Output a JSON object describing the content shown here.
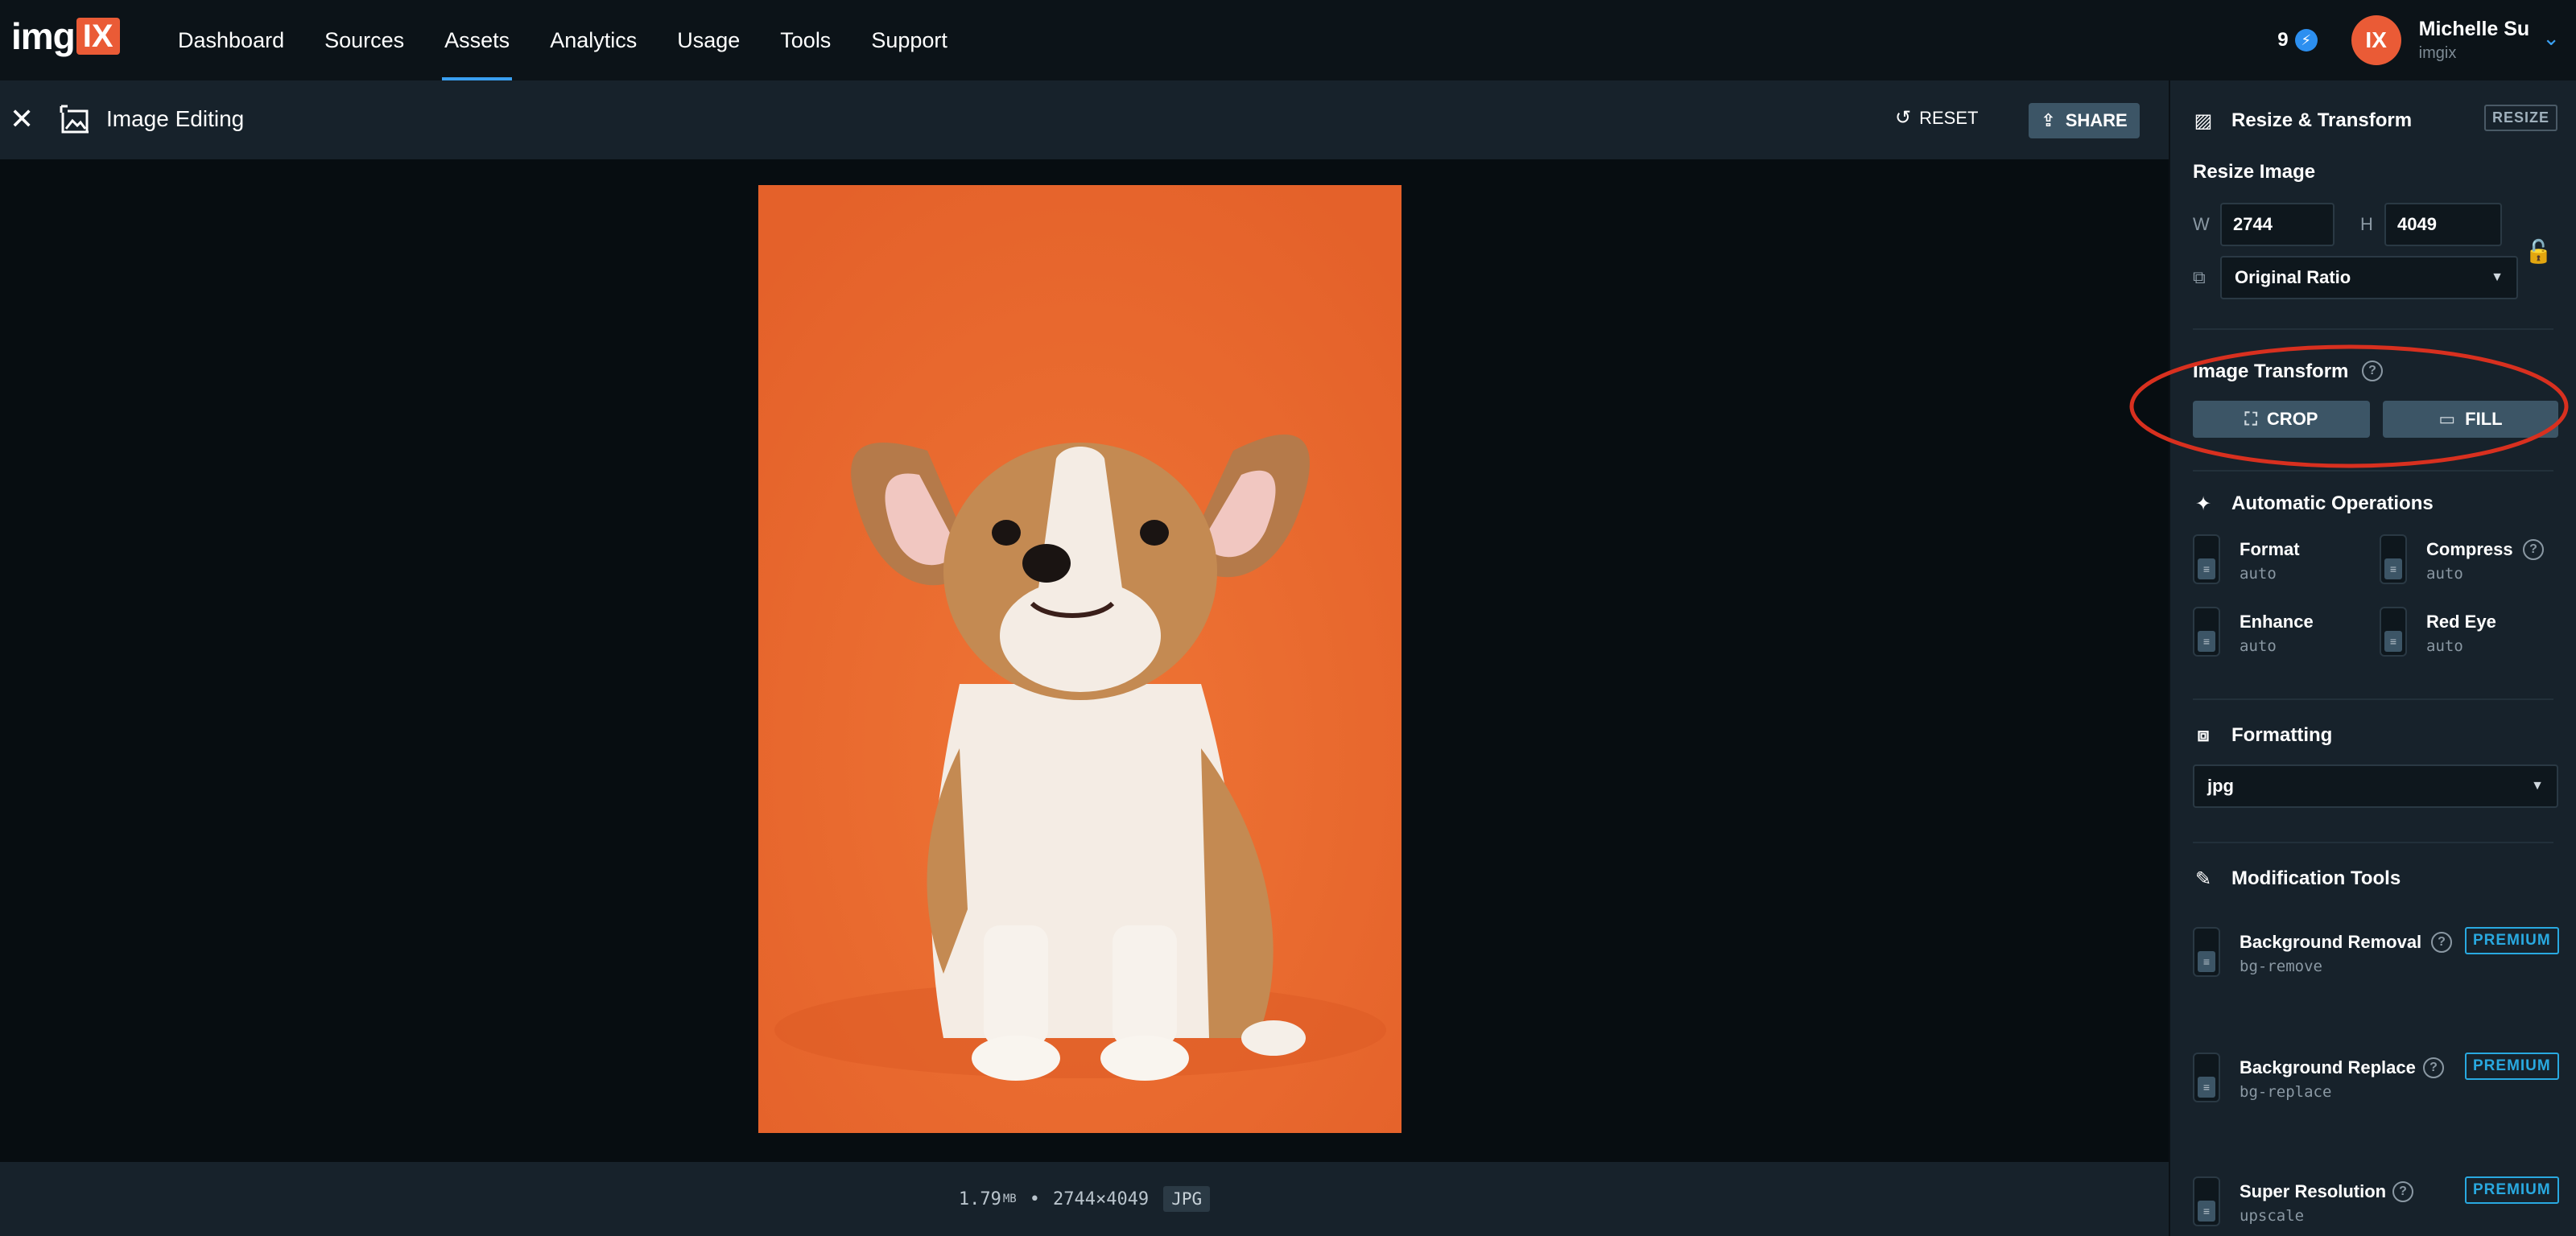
{
  "nav": {
    "logo_text": "img",
    "logo_mark": "IX",
    "items": [
      {
        "label": "Dashboard",
        "active": false
      },
      {
        "label": "Sources",
        "active": false
      },
      {
        "label": "Assets",
        "active": true
      },
      {
        "label": "Analytics",
        "active": false
      },
      {
        "label": "Usage",
        "active": false
      },
      {
        "label": "Tools",
        "active": false
      },
      {
        "label": "Support",
        "active": false
      }
    ],
    "notification_count": "9",
    "user": {
      "initials": "IX",
      "name": "Michelle Su",
      "org": "imgix"
    }
  },
  "editor": {
    "close_icon": "close-icon",
    "title": "Image Editing",
    "reset_label": "RESET",
    "share_label": "SHARE"
  },
  "image_meta": {
    "size": "1.79",
    "size_unit": "MB",
    "separator": "•",
    "dimensions": "2744×4049",
    "format": "JPG"
  },
  "panel": {
    "resize_transform": {
      "heading": "Resize & Transform",
      "badge": "RESIZE",
      "resize_label": "Resize Image",
      "w_label": "W",
      "w_value": "2744",
      "h_label": "H",
      "h_value": "4049",
      "ratio_value": "Original Ratio"
    },
    "image_transform": {
      "label": "Image Transform",
      "crop_label": "CROP",
      "fill_label": "FILL"
    },
    "automatic_ops": {
      "heading": "Automatic Operations",
      "items": [
        {
          "name": "Format",
          "value": "auto"
        },
        {
          "name": "Compress",
          "value": "auto"
        },
        {
          "name": "Enhance",
          "value": "auto"
        },
        {
          "name": "Red Eye",
          "value": "auto"
        }
      ]
    },
    "formatting": {
      "heading": "Formatting",
      "value": "jpg"
    },
    "modification_tools": {
      "heading": "Modification Tools",
      "premium_label": "PREMIUM",
      "items": [
        {
          "name": "Background Removal",
          "value": "bg-remove"
        },
        {
          "name": "Background Replace",
          "value": "bg-replace"
        },
        {
          "name": "Super Resolution",
          "value": "upscale"
        }
      ]
    }
  },
  "colors": {
    "accent": "#3a9ff0",
    "brand": "#ea5b36",
    "premium": "#29a9e0",
    "annotation": "#d8301f",
    "photo_bg": "#e8672f"
  }
}
